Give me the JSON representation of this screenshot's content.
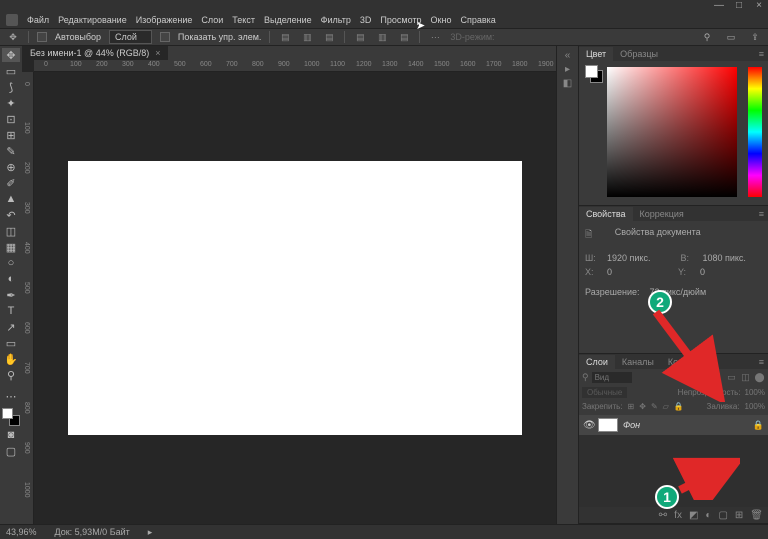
{
  "window": {
    "min": "—",
    "max": "□",
    "close": "×"
  },
  "menu": [
    "Файл",
    "Редактирование",
    "Изображение",
    "Слои",
    "Текст",
    "Выделение",
    "Фильтр",
    "3D",
    "Просмотр",
    "Окно",
    "Справка"
  ],
  "optbar": {
    "autoSelect": "Автовыбор",
    "layerDD": "Слой",
    "showCtrls": "Показать упр. элем.",
    "mode3d": "3D-режим:"
  },
  "doc": {
    "tab": "Без имени-1 @ 44% (RGB/8)",
    "close": "×"
  },
  "rulerH": [
    0,
    100,
    200,
    300,
    400,
    500,
    600,
    700,
    800,
    900,
    1000,
    1100,
    1200,
    1300,
    1400,
    1500,
    1600,
    1700,
    1800,
    1900
  ],
  "rulerV": [
    0,
    100,
    200,
    300,
    400,
    500,
    600,
    700,
    800,
    900,
    1000
  ],
  "colorPanel": {
    "t1": "Цвет",
    "t2": "Образцы"
  },
  "propsPanel": {
    "t1": "Свойства",
    "t2": "Коррекция",
    "title": "Свойства документа",
    "W": "Ш:",
    "Wv": "1920 пикс.",
    "H": "В:",
    "Hv": "1080 пикс.",
    "X": "X:",
    "Xv": "0",
    "Y": "Y:",
    "Yv": "0",
    "res": "Разрешение:",
    "resv": "72 пикс/дюйм"
  },
  "layersPanel": {
    "t1": "Слои",
    "t2": "Каналы",
    "t3": "Контуры",
    "search": "Вид",
    "blend": "Обычные",
    "opacity": "Непрозрачность:",
    "opacityv": "100%",
    "lock": "Закрепить:",
    "fill": "Заливка:",
    "fillv": "100%",
    "layerName": "Фон",
    "lockIcon": "🔒"
  },
  "status": {
    "zoom": "43,96%",
    "doc": "Док: 5,93M/0 Байт"
  },
  "annotations": {
    "n1": "1",
    "n2": "2"
  }
}
